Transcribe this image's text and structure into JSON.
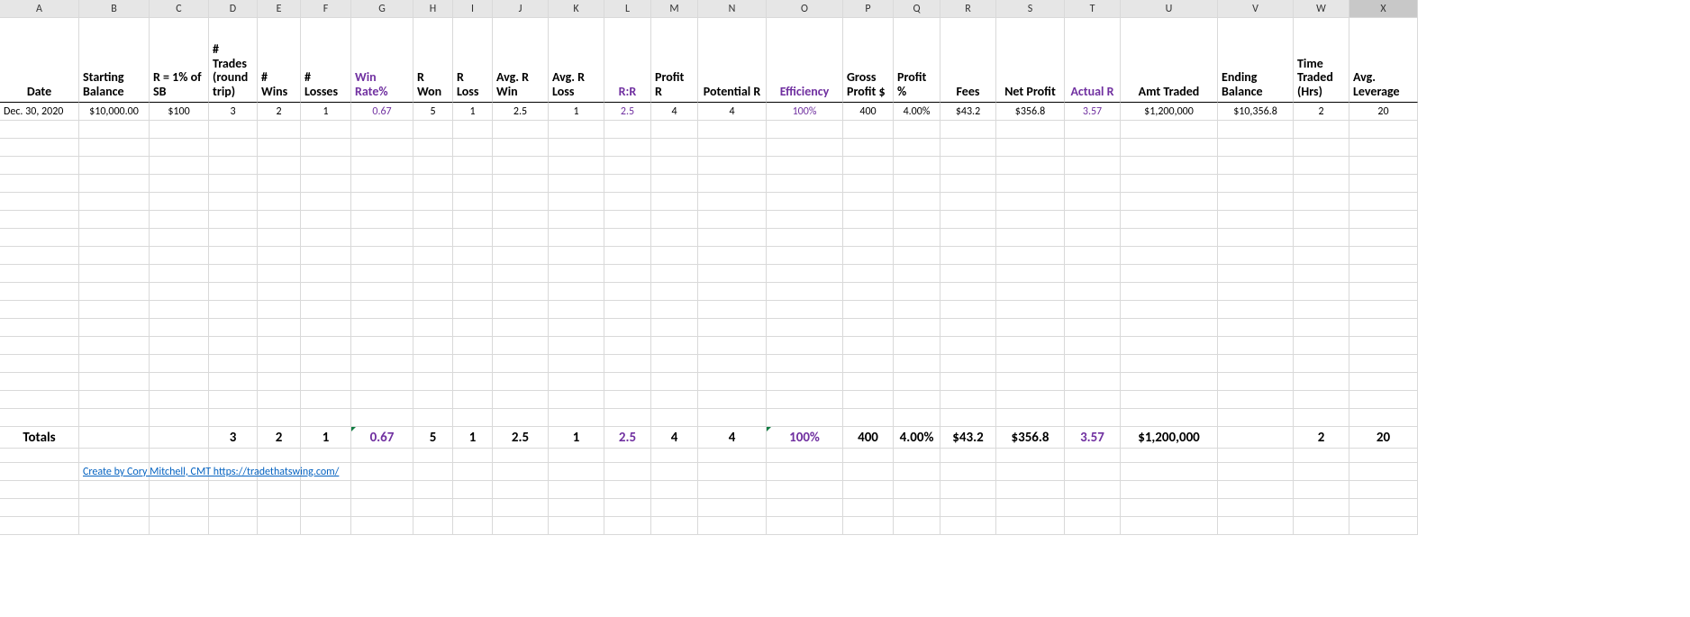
{
  "columns": {
    "letters": [
      "A",
      "B",
      "C",
      "D",
      "E",
      "F",
      "G",
      "H",
      "I",
      "J",
      "K",
      "L",
      "M",
      "N",
      "O",
      "P",
      "Q",
      "R",
      "S",
      "T",
      "U",
      "V",
      "W",
      "X"
    ],
    "widths": [
      88,
      78,
      66,
      54,
      48,
      56,
      69,
      44,
      44,
      62,
      62,
      52,
      52,
      76,
      85,
      56,
      52,
      62,
      76,
      62,
      108,
      84,
      62,
      76
    ],
    "selected": "X"
  },
  "headers": {
    "A": "Date",
    "B": "Starting Balance",
    "C": "R = 1% of SB",
    "D": "# Trades (round trip)",
    "E": "# Wins",
    "F": "# Losses",
    "G": "Win Rate%",
    "H": "R Won",
    "I": "R Loss",
    "J": "Avg. R Win",
    "K": "Avg. R Loss",
    "L": "R:R",
    "M": "Profit R",
    "N": "Potential R",
    "O": "Efficiency",
    "P": "Gross Profit $",
    "Q": "Profit %",
    "R": "Fees",
    "S": "Net Profit",
    "T": "Actual R",
    "U": "Amt Traded",
    "V": "Ending Balance",
    "W": "Time Traded (Hrs)",
    "X": "Avg. Leverage"
  },
  "data_row": {
    "A": "Dec. 30, 2020",
    "B": "$10,000.00",
    "C": "$100",
    "D": "3",
    "E": "2",
    "F": "1",
    "G": "0.67",
    "H": "5",
    "I": "1",
    "J": "2.5",
    "K": "1",
    "L": "2.5",
    "M": "4",
    "N": "4",
    "O": "100%",
    "P": "400",
    "Q": "4.00%",
    "R": "$43.2",
    "S": "$356.8",
    "T": "3.57",
    "U": "$1,200,000",
    "V": "$10,356.8",
    "W": "2",
    "X": "20"
  },
  "totals_row": {
    "A": "Totals",
    "B": "",
    "C": "",
    "D": "3",
    "E": "2",
    "F": "1",
    "G": "0.67",
    "H": "5",
    "I": "1",
    "J": "2.5",
    "K": "1",
    "L": "2.5",
    "M": "4",
    "N": "4",
    "O": "100%",
    "P": "400",
    "Q": "4.00%",
    "R": "$43.2",
    "S": "$356.8",
    "T": "3.57",
    "U": "$1,200,000",
    "V": "",
    "W": "2",
    "X": "20"
  },
  "purple_cols": [
    "G",
    "L",
    "O",
    "T"
  ],
  "credit": "Create by Cory Mitchell, CMT https://tradethatswing.com/",
  "empty_rows_before_totals": 17,
  "empty_rows_after_totals": 1,
  "green_tick_cells": {
    "totals": [
      "G",
      "O"
    ]
  }
}
